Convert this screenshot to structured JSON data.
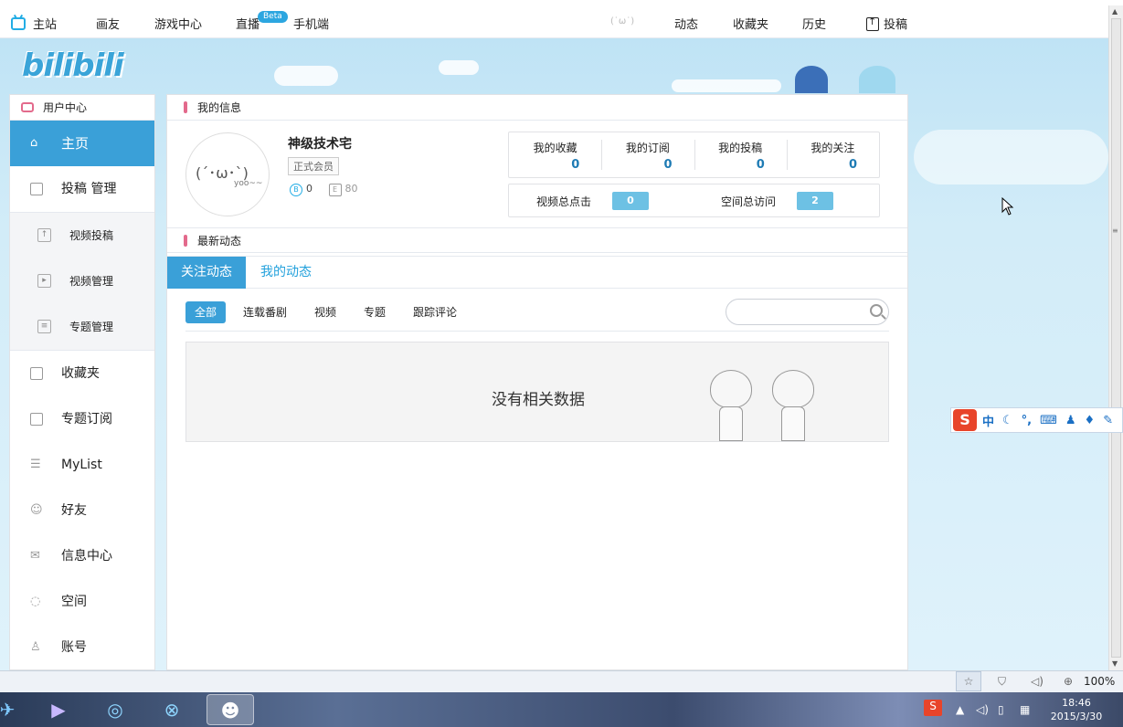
{
  "topnav": {
    "home": "主站",
    "painter": "画友",
    "games": "游戏中心",
    "live": "直播",
    "live_badge": "Beta",
    "mobile": "手机端",
    "loading_face": "(˙ω˙)",
    "activity": "动态",
    "favorites": "收藏夹",
    "history": "历史",
    "upload": "投稿"
  },
  "logo": "bilibili",
  "sidebar": {
    "header": "用户中心",
    "items": [
      {
        "label": "主页",
        "icon": "home-icon"
      },
      {
        "label": "投稿 管理",
        "icon": "upload-icon"
      }
    ],
    "subitems": [
      {
        "label": "视频投稿",
        "icon": "upload-icon"
      },
      {
        "label": "视频管理",
        "icon": "play-icon"
      },
      {
        "label": "专题管理",
        "icon": "list-icon"
      }
    ],
    "items2": [
      {
        "label": "收藏夹",
        "icon": "folder-icon"
      },
      {
        "label": "专题订阅",
        "icon": "chart-icon"
      },
      {
        "label": "MyList",
        "icon": "list-icon"
      },
      {
        "label": "好友",
        "icon": "friend-icon"
      },
      {
        "label": "信息中心",
        "icon": "message-icon"
      },
      {
        "label": "空间",
        "icon": "space-icon"
      },
      {
        "label": "账号",
        "icon": "account-icon"
      }
    ]
  },
  "info": {
    "title": "我的信息",
    "avatar_face": "(´･ω･`)",
    "avatar_text": "yoo~~",
    "username": "神级技术宅",
    "rank": "正式会员",
    "coins": "0",
    "level": "80",
    "stats": [
      {
        "label": "我的收藏",
        "value": "0"
      },
      {
        "label": "我的订阅",
        "value": "0"
      },
      {
        "label": "我的投稿",
        "value": "0"
      },
      {
        "label": "我的关注",
        "value": "0"
      }
    ],
    "video_clicks_label": "视频总点击",
    "video_clicks": "0",
    "space_visits_label": "空间总访问",
    "space_visits": "2"
  },
  "feed": {
    "title": "最新动态",
    "tabs": [
      "关注动态",
      "我的动态"
    ],
    "filters": [
      "全部",
      "连载番剧",
      "视频",
      "专题",
      "跟踪评论"
    ],
    "search_placeholder": "",
    "empty": "没有相关数据"
  },
  "ime": {
    "lang": "中"
  },
  "status": {
    "zoom": "100%"
  },
  "taskbar": {
    "time": "18:46",
    "date": "2015/3/30"
  }
}
